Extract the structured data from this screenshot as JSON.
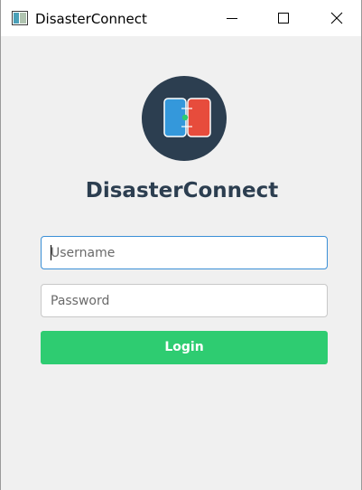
{
  "window": {
    "title": "DisasterConnect",
    "controls": {
      "minimize_icon": "minimize-icon",
      "maximize_icon": "maximize-icon",
      "close_icon": "close-icon"
    }
  },
  "brand": {
    "logo_icon": "connected-pages-logo",
    "name": "DisasterConnect"
  },
  "form": {
    "username": {
      "value": "",
      "placeholder": "Username"
    },
    "password": {
      "value": "",
      "placeholder": "Password"
    },
    "login_label": "Login"
  },
  "colors": {
    "brand_dark": "#2c3e50",
    "accent_green": "#2ecc71",
    "logo_blue": "#3498db",
    "logo_red": "#e74c3c",
    "focus_border": "#3a8fd6"
  }
}
